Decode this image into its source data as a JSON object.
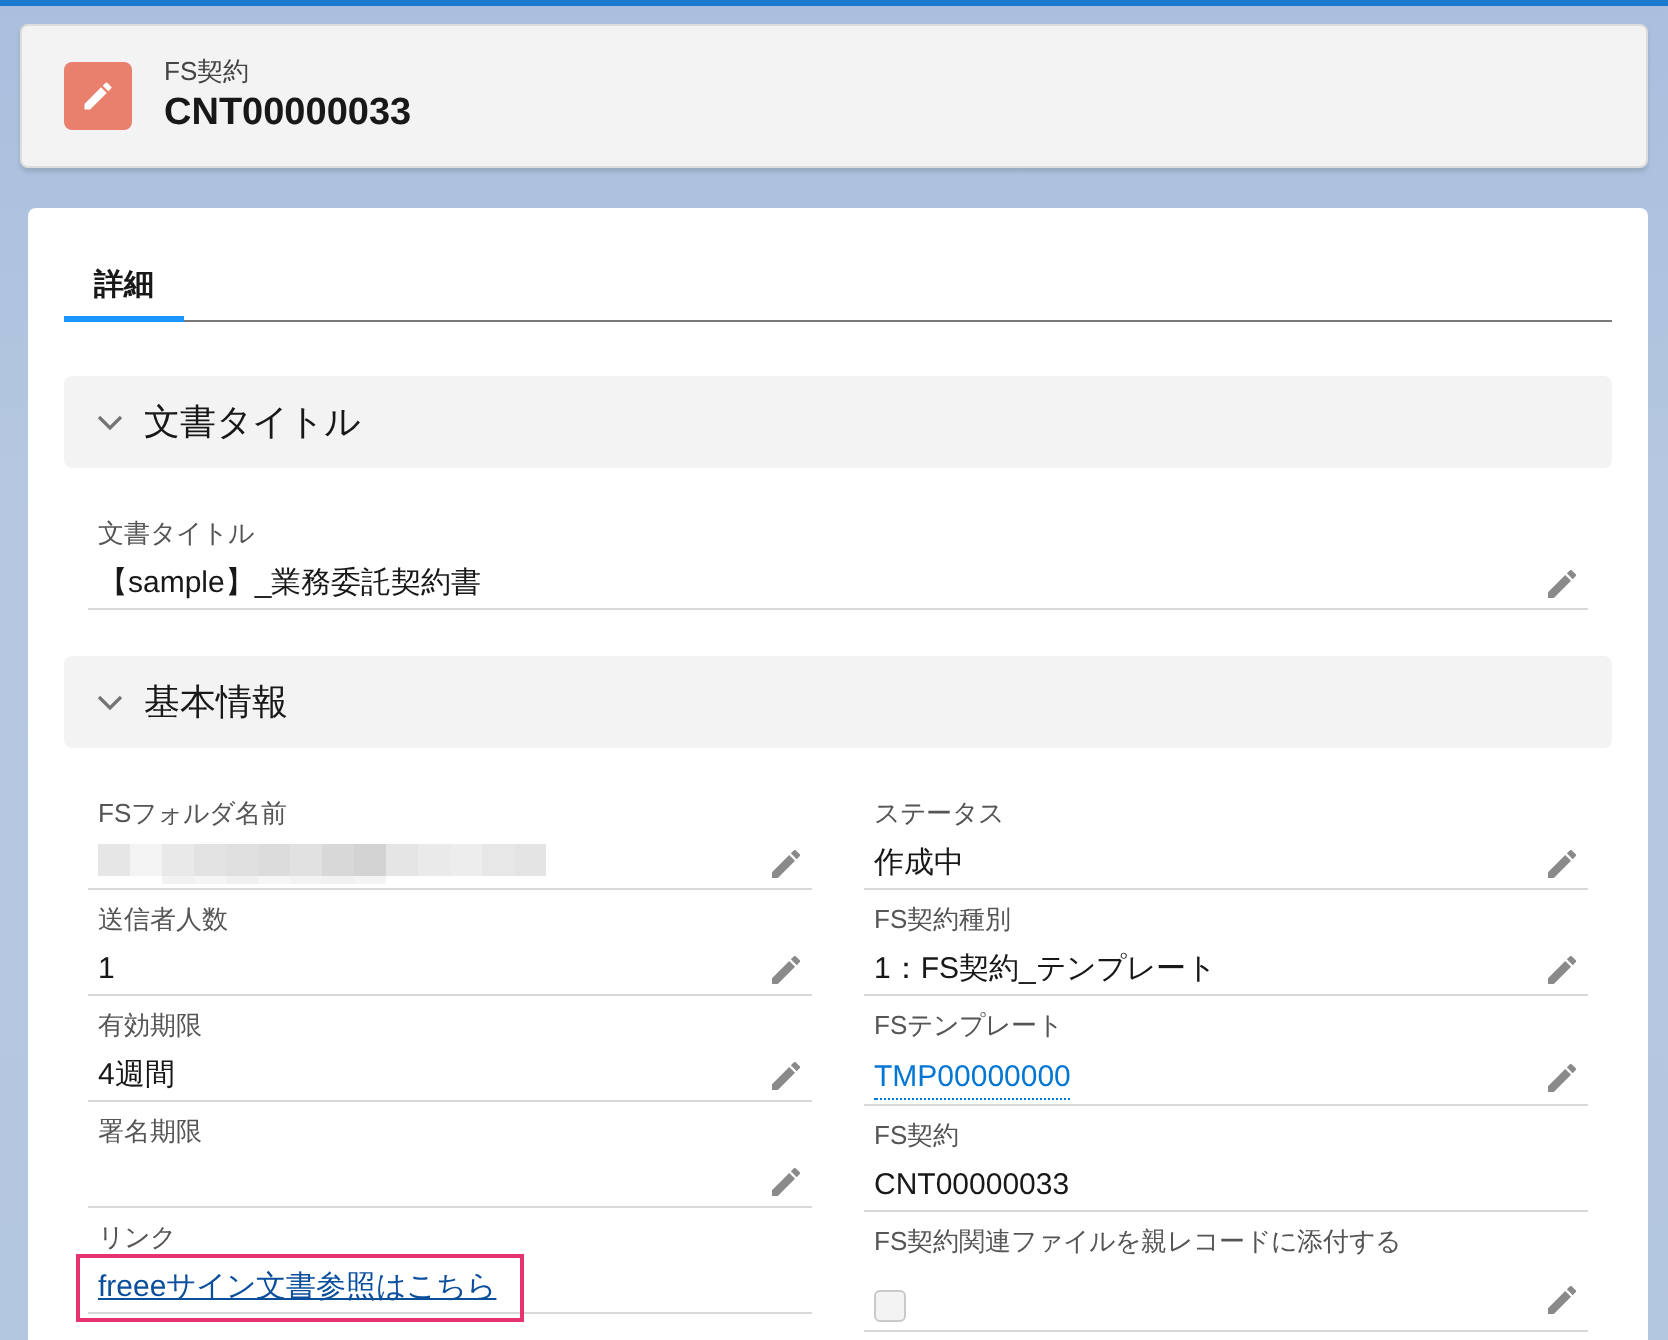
{
  "header": {
    "object_label": "FS契約",
    "record_name": "CNT00000033"
  },
  "tabs": [
    {
      "label": "詳細",
      "selected": true
    }
  ],
  "sections": [
    {
      "title": "文書タイトル",
      "expanded": true,
      "columns": [
        [
          {
            "kind": "text",
            "label": "文書タイトル",
            "value": "【sample】_業務委託契約書",
            "editable": true
          }
        ]
      ]
    },
    {
      "title": "基本情報",
      "expanded": true,
      "columns": [
        [
          {
            "kind": "redacted",
            "label": "FSフォルダ名前",
            "editable": true
          },
          {
            "kind": "text",
            "label": "送信者人数",
            "value": "1",
            "editable": true
          },
          {
            "kind": "text",
            "label": "有効期限",
            "value": "4週間",
            "editable": true
          },
          {
            "kind": "text",
            "label": "署名期限",
            "editable": true
          },
          {
            "kind": "link",
            "label": "リンク",
            "value": "freeeサイン文書参照はこちら",
            "editable": false,
            "highlighted": true
          }
        ],
        [
          {
            "kind": "text",
            "label": "ステータス",
            "value": "作成中",
            "editable": true
          },
          {
            "kind": "text",
            "label": "FS契約種別",
            "value": "1：FS契約_テンプレート",
            "editable": true
          },
          {
            "kind": "lookup",
            "label": "FSテンプレート",
            "value": "TMP00000000",
            "editable": true
          },
          {
            "kind": "text",
            "label": "FS契約",
            "value": "CNT00000033",
            "editable": false
          },
          {
            "kind": "checkbox",
            "label": "FS契約関連ファイルを親レコードに添付する",
            "checked": false,
            "editable": true
          }
        ]
      ]
    }
  ]
}
